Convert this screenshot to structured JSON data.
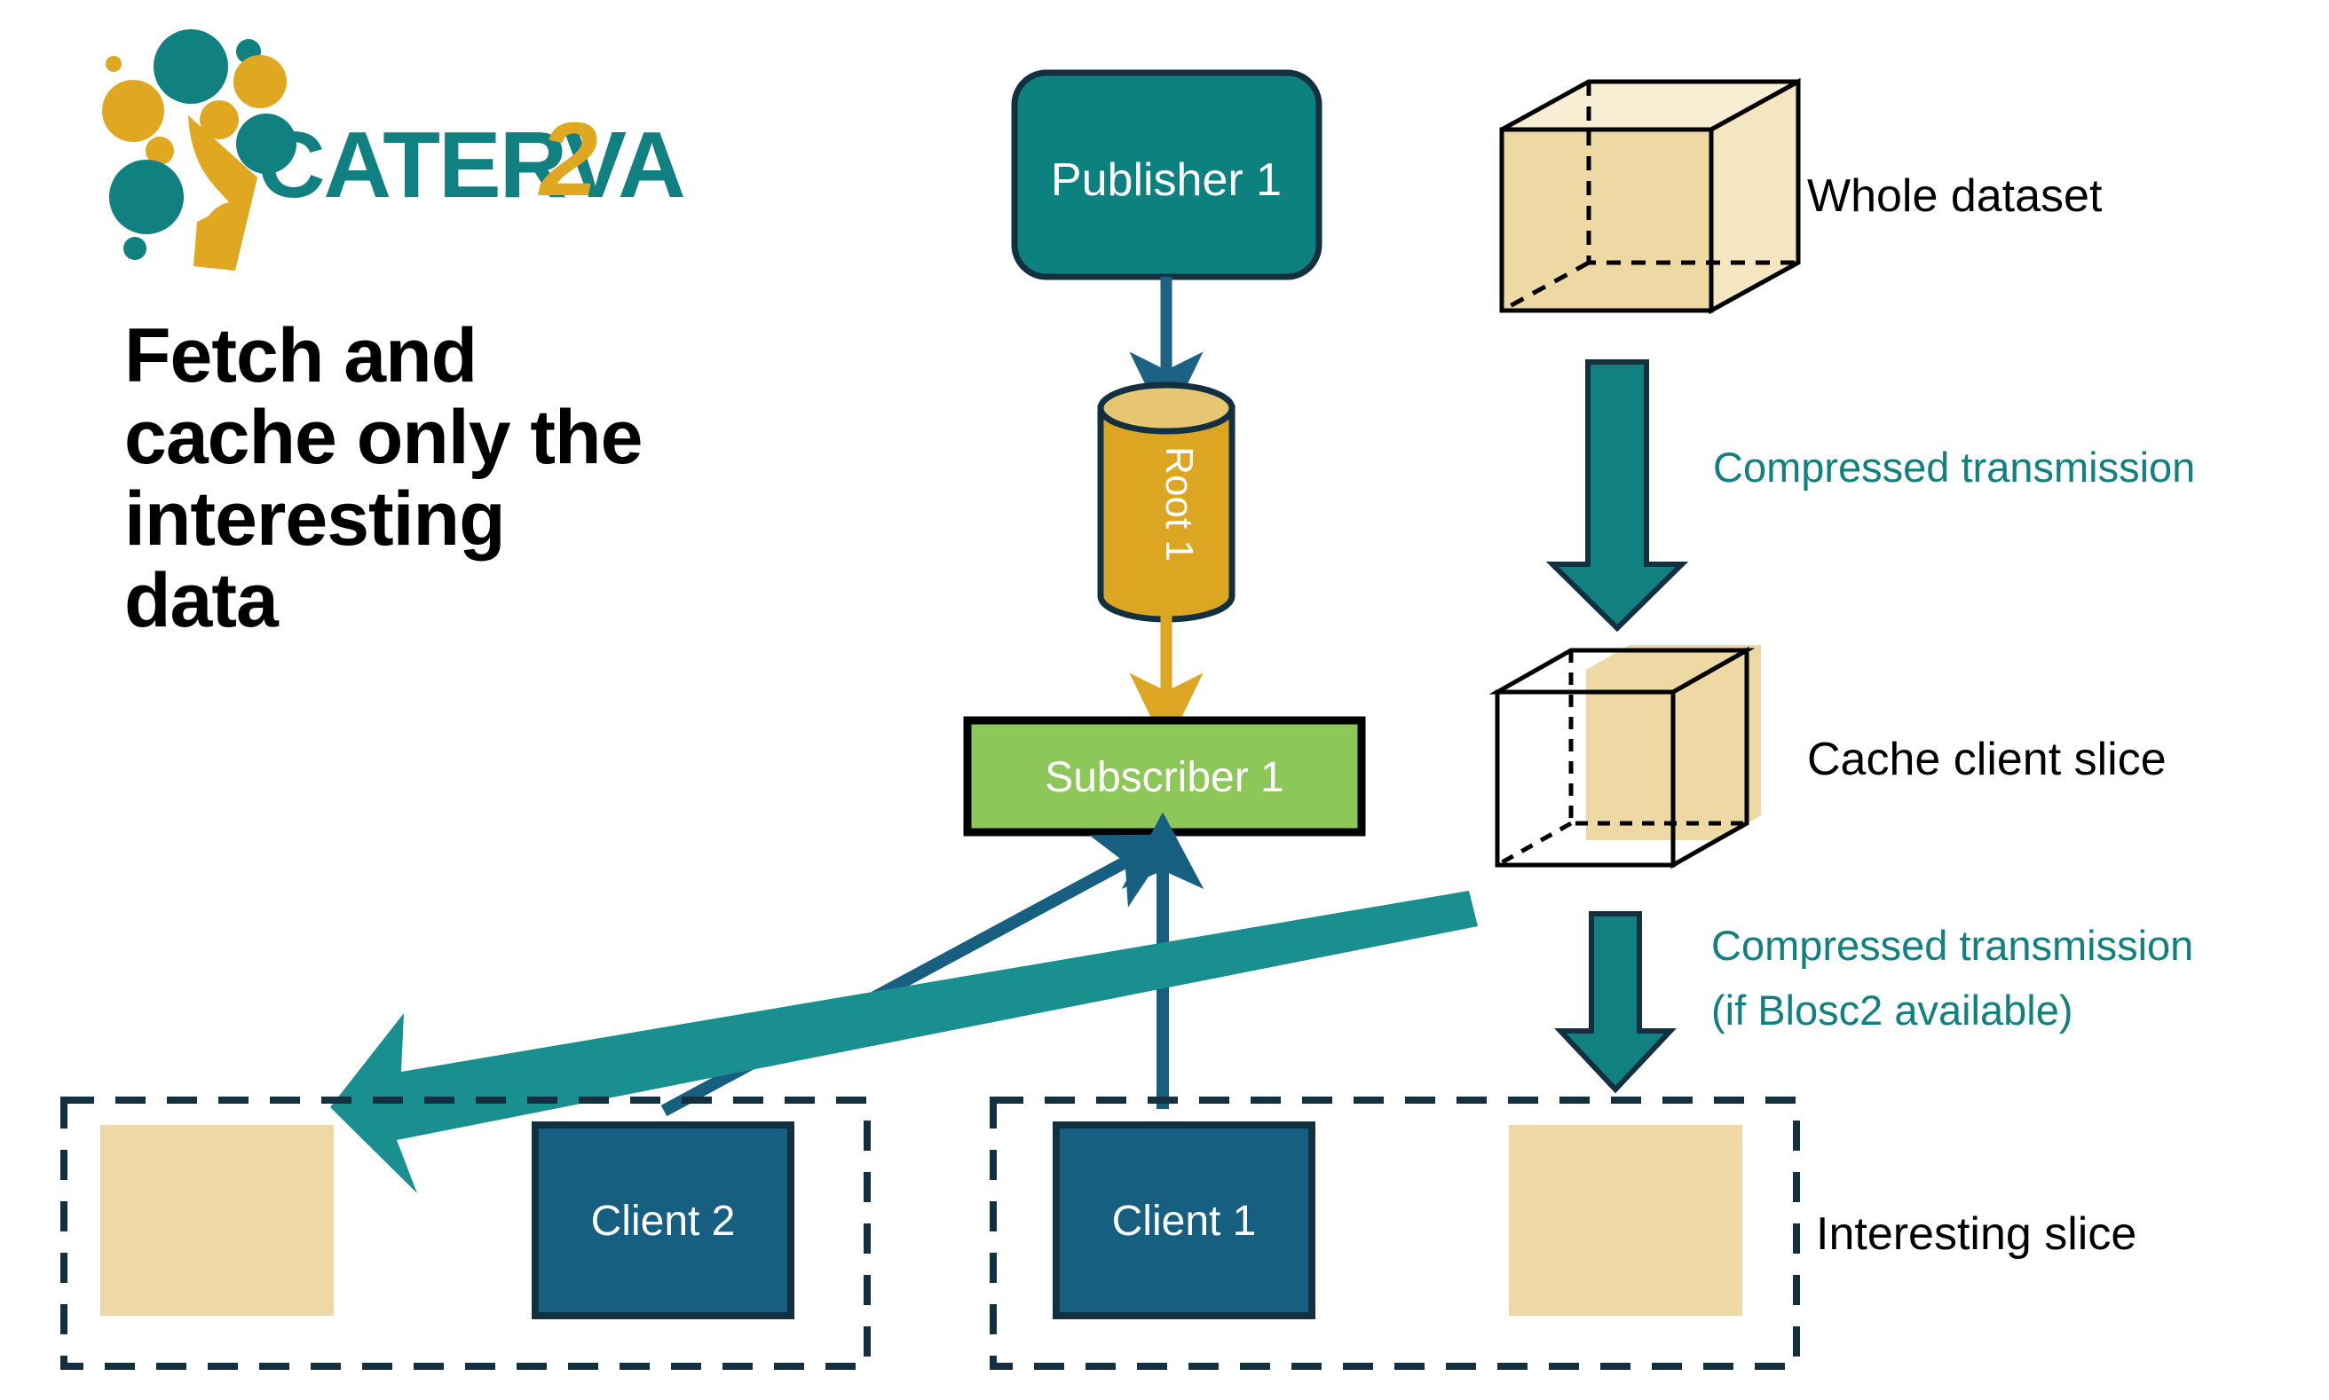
{
  "brand": {
    "logo_name": "caterva2-logo",
    "wordmark": "CATERVA",
    "wordmark_suffix": "2",
    "teal": "#108080",
    "gold": "#e0a820"
  },
  "headline": {
    "lines": [
      "Fetch and",
      "cache only the",
      "interesting",
      "data"
    ],
    "color": "#000000"
  },
  "nodes": {
    "publisher": {
      "label": "Publisher 1",
      "fill": "#0d8080",
      "stroke": "#12303f",
      "text_color": "#ffffff"
    },
    "root": {
      "label": "Root 1",
      "fill": "#dca622",
      "top_fill": "#e7c672",
      "stroke": "#12303f",
      "text_color": "#ffffff"
    },
    "subscriber": {
      "label": "Subscriber 1",
      "fill": "#8dc75a",
      "stroke": "#000000",
      "text_color": "#ffffff"
    },
    "client1": {
      "label": "Client 1",
      "fill": "#175f80",
      "stroke": "#12303f",
      "text_color": "#ffffff"
    },
    "client2": {
      "label": "Client 2",
      "fill": "#175f80",
      "stroke": "#12303f",
      "text_color": "#ffffff"
    }
  },
  "connectors": {
    "publisher_to_root": {
      "name": "publisher-to-root-arrow",
      "color": "#1d6285"
    },
    "root_to_subscriber": {
      "name": "root-to-subscriber-arrow",
      "color": "#dca622"
    },
    "client1_to_subscriber": {
      "name": "client1-to-subscriber-arrow",
      "color": "#175f80"
    },
    "client2_to_subscriber": {
      "name": "client2-to-subscriber-arrow",
      "color": "#175f80"
    },
    "subscriber_to_client2_data": {
      "name": "data-return-arrow",
      "color": "#1a8f8f"
    }
  },
  "right_column": {
    "whole_dataset": {
      "label": "Whole dataset",
      "color": "#000000",
      "cube_front": "#eed9a4",
      "cube_top": "#f8eed3",
      "cube_side": "#f5e6c2",
      "cube_edge": "#000000"
    },
    "transmission_1": {
      "lines": [
        "Compressed transmission"
      ],
      "color": "#108080",
      "arrow_fill": "#108080",
      "arrow_stroke": "#12303f"
    },
    "cache_client_slice": {
      "label": "Cache client slice",
      "color": "#000000",
      "cube_edge": "#000000",
      "slice_fill": "#eed9a4"
    },
    "transmission_2": {
      "lines": [
        "Compressed transmission",
        "(if Blosc2 available)"
      ],
      "color": "#108080",
      "arrow_fill": "#108080",
      "arrow_stroke": "#12303f"
    },
    "interesting_slice": {
      "label": "Interesting slice",
      "color": "#000000"
    }
  },
  "bottom": {
    "group_left": {
      "name": "client2-group-dashed-box",
      "stroke": "#12303f"
    },
    "group_right": {
      "name": "client1-group-dashed-box",
      "stroke": "#12303f"
    },
    "slice_block_fill": "#eed9a4"
  }
}
